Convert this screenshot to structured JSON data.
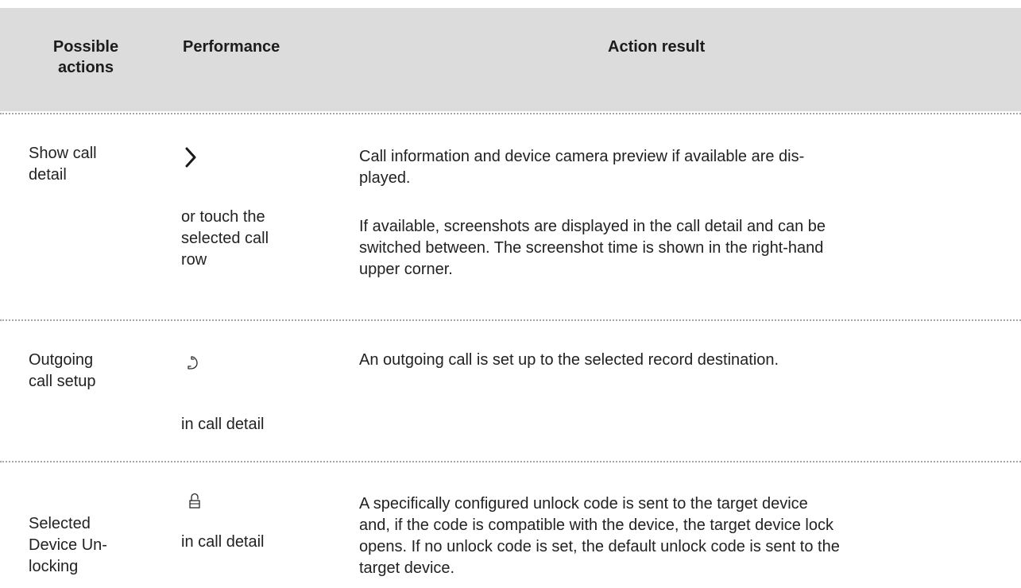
{
  "header": {
    "col_actions": "Possible actions",
    "col_actions_line1": "Possible",
    "col_actions_line2": "actions",
    "col_performance": "Performance",
    "col_result": "Action result"
  },
  "rows": [
    {
      "action": "Show call detail",
      "action_line1": "Show call",
      "action_line2": "detail",
      "icon": "chevron-right-icon",
      "performance_text": "or touch the selected call row",
      "performance_line1": "or touch the",
      "performance_line2": "selected call",
      "performance_line3": "row",
      "result_p1_line1": "Call information and device camera preview if available are dis-",
      "result_p1_line2": "played.",
      "result_p2_line1": "If available, screenshots are displayed in the call detail and can be",
      "result_p2_line2": "switched between. The screenshot time is shown in the right-hand",
      "result_p2_line3": "upper corner."
    },
    {
      "action": "Outgoing call setup",
      "action_line1": "Outgoing",
      "action_line2": "call setup",
      "icon": "phone-handset-icon",
      "performance_text": "in call detail",
      "result_p1_line1": "An outgoing call is set up to the selected record destination."
    },
    {
      "action": "Selected Device Unlocking",
      "action_line1": "Selected",
      "action_line2": "Device Un-",
      "action_line3": "locking",
      "icon": "lock-icon",
      "performance_text": "in call detail",
      "result_p1_line1": "A specifically configured unlock code is sent to the target device",
      "result_p1_line2": "and, if the code is compatible with the device, the target device lock",
      "result_p1_line3": "opens. If no unlock code is set, the default unlock code is sent to the",
      "result_p1_line4": "target device."
    }
  ],
  "colors": {
    "header_bg": "#dcdcdc",
    "separator": "#a6a6a6",
    "text": "#222222"
  }
}
